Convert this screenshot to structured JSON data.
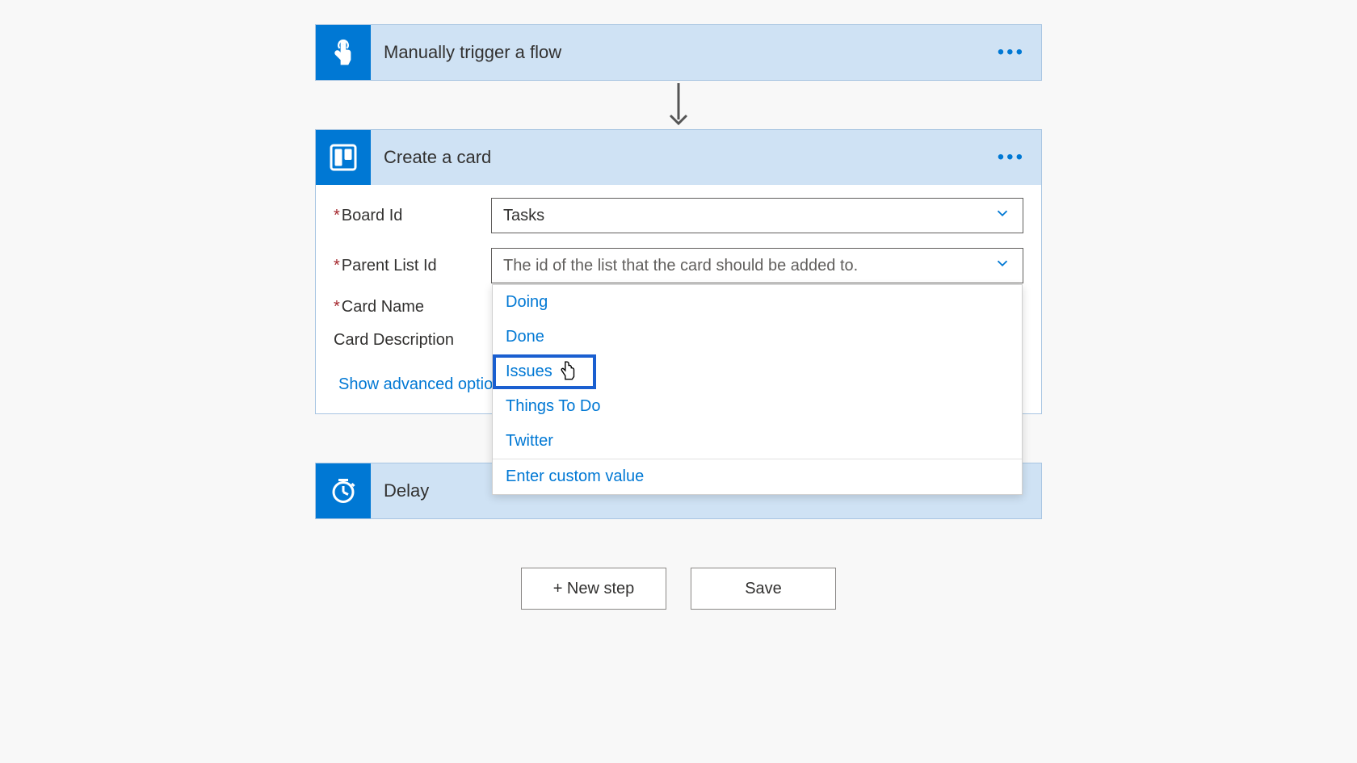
{
  "steps": {
    "trigger": {
      "title": "Manually trigger a flow"
    },
    "createCard": {
      "title": "Create a card",
      "fields": {
        "boardId": {
          "label": "Board Id",
          "value": "Tasks"
        },
        "parentListId": {
          "label": "Parent List Id",
          "placeholder": "The id of the list that the card should be added to."
        },
        "cardName": {
          "label": "Card Name"
        },
        "cardDescription": {
          "label": "Card Description"
        }
      },
      "dropdownOptions": {
        "option0": "Doing",
        "option1": "Done",
        "option2": "Issues",
        "option3": "Things To Do",
        "option4": "Twitter",
        "customValue": "Enter custom value"
      },
      "showAdvanced": "Show advanced options"
    },
    "delay": {
      "title": "Delay"
    }
  },
  "buttons": {
    "newStep": "+ New step",
    "save": "Save"
  },
  "menu": "•••"
}
